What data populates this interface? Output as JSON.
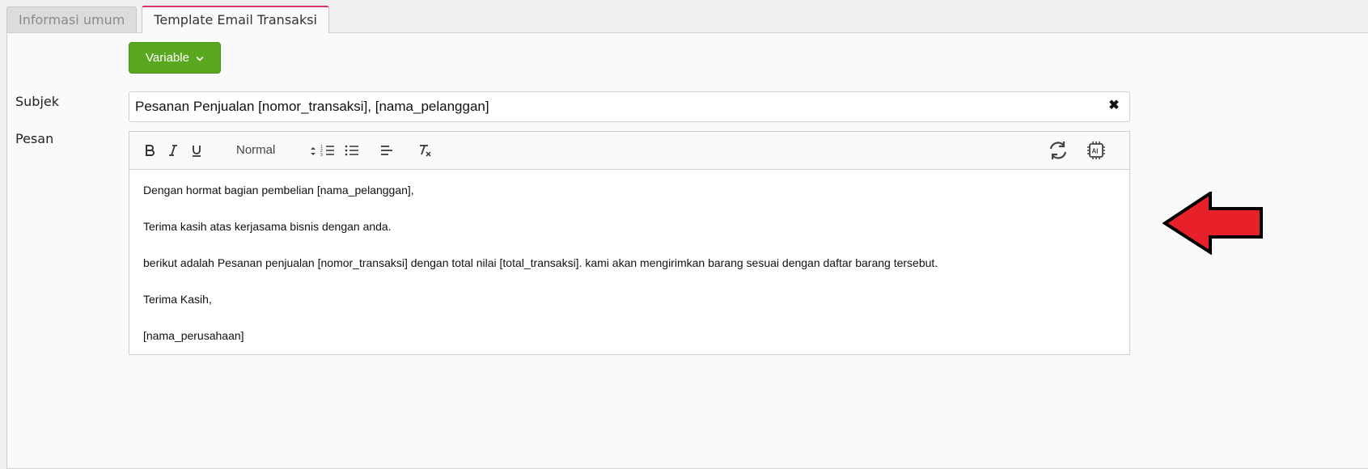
{
  "tabs": [
    {
      "label": "Informasi umum",
      "active": false
    },
    {
      "label": "Template Email Transaksi",
      "active": true
    }
  ],
  "variable_button": {
    "label": "Variable",
    "icon": "chevron-down-icon"
  },
  "subject": {
    "label": "Subjek",
    "value": "Pesanan Penjualan [nomor_transaksi], [nama_pelanggan]",
    "clear_icon": "✖"
  },
  "message": {
    "label": "Pesan",
    "toolbar": {
      "format_value": "Normal",
      "buttons": [
        "bold",
        "italic",
        "underline",
        "ordered-list",
        "bullet-list",
        "align",
        "clear-format",
        "refresh",
        "ai"
      ]
    },
    "paragraphs": [
      "Dengan hormat bagian pembelian [nama_pelanggan],",
      "Terima kasih atas kerjasama bisnis dengan anda.",
      "berikut adalah Pesanan penjualan [nomor_transaksi] dengan total nilai [total_transaksi]. kami akan mengirimkan barang sesuai dengan daftar barang tersebut.",
      "Terima Kasih,",
      "[nama_perusahaan]"
    ]
  },
  "colors": {
    "variable_button": "#5aa81f",
    "active_tab_border": "#d6336c",
    "arrow_fill": "#e8202a"
  }
}
